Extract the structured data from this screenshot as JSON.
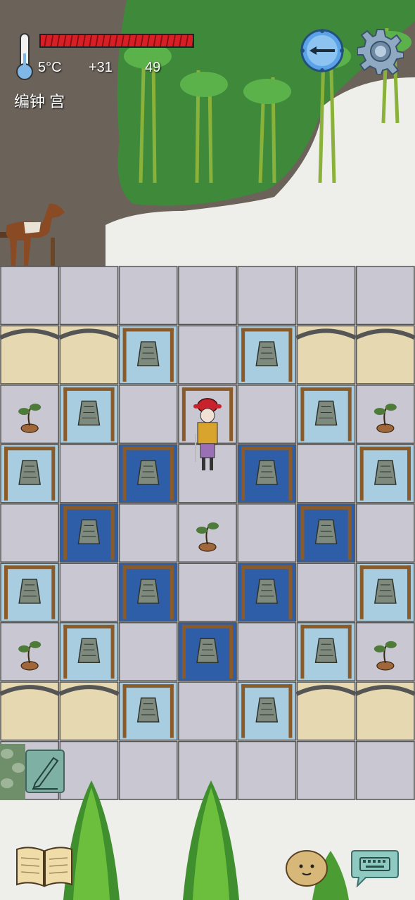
{
  "hud": {
    "temperature": "5°C",
    "heat": "+31",
    "food": "49",
    "location": "编钟 宫",
    "health_fraction": 1.0
  },
  "board": {
    "rows": [
      [
        "stone",
        "stone",
        "stone",
        "stone",
        "stone",
        "stone",
        "stone"
      ],
      [
        "bridge",
        "bridge",
        "bell-light",
        "stone",
        "bell-light",
        "bridge",
        "bridge"
      ],
      [
        "bonsai",
        "bell-light",
        "stone",
        "player-gate",
        "stone",
        "bell-light",
        "bonsai"
      ],
      [
        "bell-light",
        "stone",
        "bell-dark",
        "stone",
        "bell-dark",
        "stone",
        "bell-light"
      ],
      [
        "stone",
        "bell-dark",
        "stone",
        "bonsai",
        "stone",
        "bell-dark",
        "stone"
      ],
      [
        "bell-light",
        "stone",
        "bell-dark",
        "stone",
        "bell-dark",
        "stone",
        "bell-light"
      ],
      [
        "bonsai",
        "bell-light",
        "stone",
        "bell-dark",
        "stone",
        "bell-light",
        "bonsai"
      ],
      [
        "bridge",
        "bridge",
        "bell-light",
        "stone",
        "bell-light",
        "bridge",
        "bridge"
      ],
      [
        "stone",
        "stone",
        "stone",
        "stone",
        "stone",
        "stone",
        "stone"
      ]
    ]
  },
  "icons": {
    "thermometer": "thermometer-icon",
    "compass": "compass-icon",
    "settings": "gear-icon",
    "journal": "book-icon",
    "companion": "potato-icon",
    "chat": "keyboard-icon",
    "note": "pen-icon"
  },
  "colors": {
    "health": "#d81f26",
    "bell_light": "#a9cde0",
    "bell_dark": "#2f5ea8",
    "stone": "#c9c7d2",
    "grass": "#3e8a3a"
  }
}
